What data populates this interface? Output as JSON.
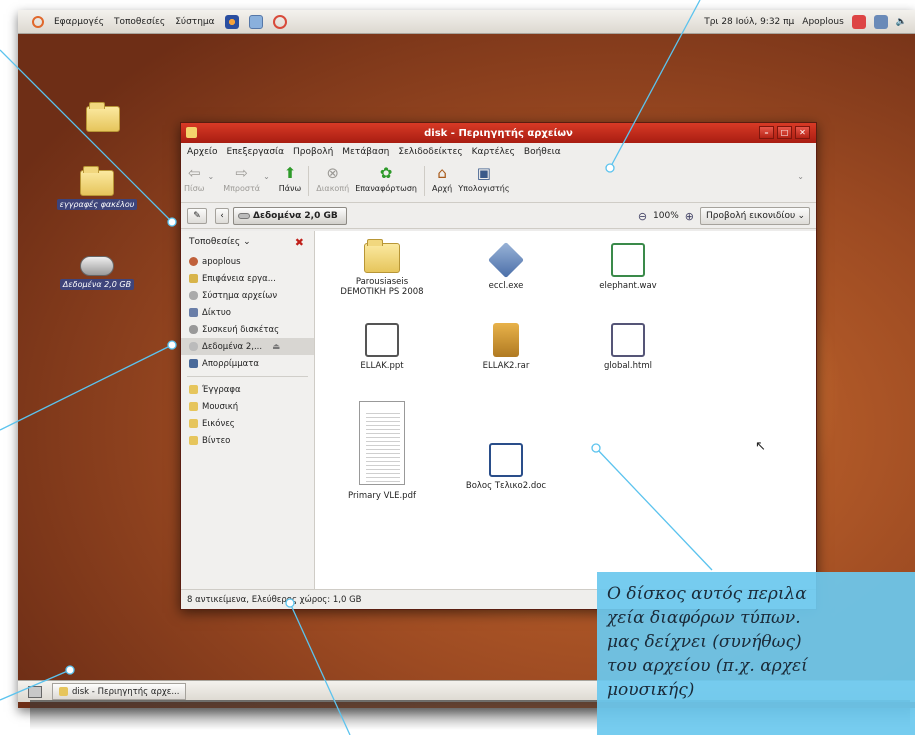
{
  "top_panel": {
    "menus": [
      "Εφαρμογές",
      "Τοποθεσίες",
      "Σύστημα"
    ],
    "clock": "Τρι 28 Ιούλ, 9:32 πμ",
    "user": "Apoplous"
  },
  "desktop": {
    "icon1_label": "εγγραφές φακέλου",
    "icon2_label": "Δεδομένα 2,0 GB"
  },
  "window": {
    "title": "disk - Περιηγητής αρχείων",
    "menu": [
      "Αρχείο",
      "Επεξεργασία",
      "Προβολή",
      "Μετάβαση",
      "Σελιδοδείκτες",
      "Καρτέλες",
      "Βοήθεια"
    ],
    "toolbar": {
      "back": "Πίσω",
      "forward": "Μπροστά",
      "up": "Πάνω",
      "stop": "Διακοπή",
      "reload": "Επαναφόρτωση",
      "home": "Αρχή",
      "computer": "Υπολογιστής"
    },
    "location": {
      "crumb": "Δεδομένα 2,0 GB",
      "zoom": "100%",
      "view": "Προβολή εικονιδίου"
    },
    "sidebar": {
      "header": "Τοποθεσίες",
      "items": [
        "apoplous",
        "Επιφάνεια εργα...",
        "Σύστημα αρχείων",
        "Δίκτυο",
        "Συσκευή δισκέτας",
        "Δεδομένα 2,...",
        "Απορρίμματα",
        "Έγγραφα",
        "Μουσική",
        "Εικόνες",
        "Βίντεο"
      ]
    },
    "files": [
      {
        "name_line1": "Parousiaseis",
        "name_line2": "DEMOTIKH PS 2008"
      },
      {
        "name_line1": "eccl.exe"
      },
      {
        "name_line1": "elephant.wav"
      },
      {
        "name_line1": "ELLAK.ppt"
      },
      {
        "name_line1": "ELLAK2.rar"
      },
      {
        "name_line1": "global.html"
      },
      {
        "name_line1": "Primary VLE.pdf"
      },
      {
        "name_line1": "Βολος Τελικο2.doc"
      }
    ],
    "status": "8 αντικείμενα, Ελεύθερος χώρος: 1,0 GB"
  },
  "taskbar": {
    "task": "disk - Περιηγητής αρχε..."
  },
  "callout": {
    "line1": "Ο δίσκος αυτός περιλα",
    "line2": "χεία διαφόρων τύπων.",
    "line3": "μας δείχνει (συνήθως)",
    "line4": "του αρχείου (π.χ. αρχεί",
    "line5": "μουσικής)"
  },
  "colors": {
    "titlebar": "#c02a1a",
    "callout_bg": "#6cc8ee",
    "callout_line": "#5bc3ee"
  }
}
